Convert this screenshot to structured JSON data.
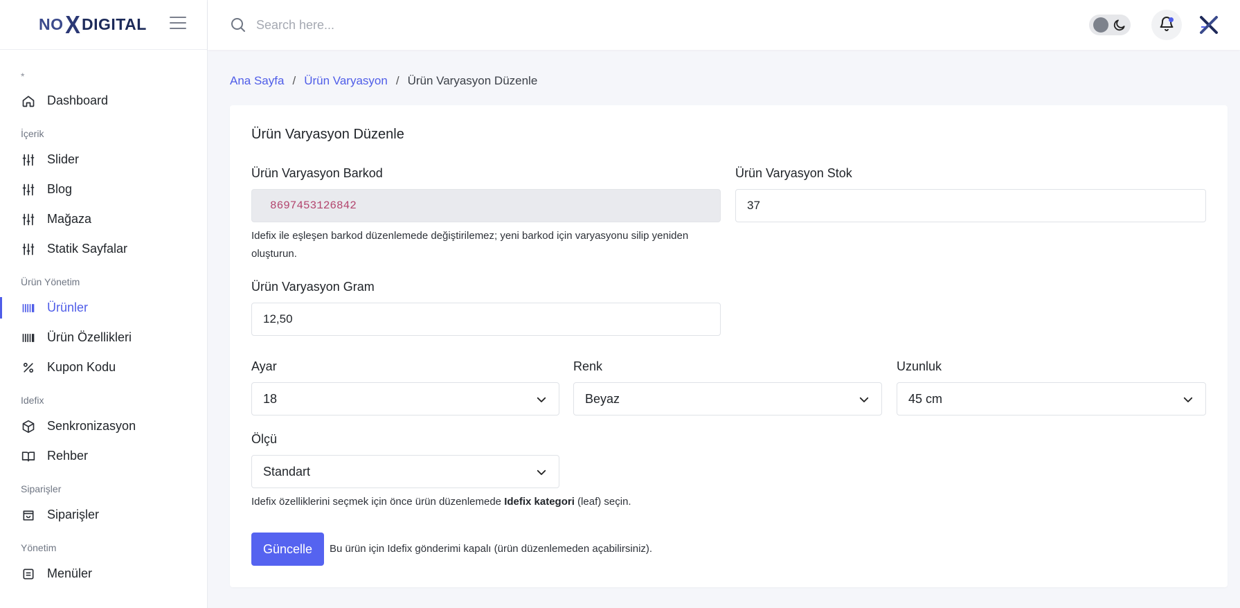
{
  "brand": {
    "logo_left": "NO",
    "logo_x": "X",
    "logo_right": "DIGITAL"
  },
  "colors": {
    "accent": "#4f5de8",
    "button": "#5563f0",
    "barcode_text": "#b3456e"
  },
  "sidebar": {
    "star": "*",
    "dashboard": "Dashboard",
    "sections": {
      "icerik": "İçerik",
      "urun_yonetim": "Ürün Yönetim",
      "idefix": "Idefix",
      "siparisler": "Siparişler",
      "yonetim": "Yönetim"
    },
    "items": {
      "slider": "Slider",
      "blog": "Blog",
      "magaza": "Mağaza",
      "statik": "Statik Sayfalar",
      "urunler": "Ürünler",
      "urun_ozellikleri": "Ürün Özellikleri",
      "kupon": "Kupon Kodu",
      "senkronizasyon": "Senkronizasyon",
      "rehber": "Rehber",
      "siparisler": "Siparişler",
      "menuler": "Menüler"
    },
    "icons": {
      "dashboard": "home-icon",
      "slider": "sliders-icon",
      "blog": "sliders-icon",
      "magaza": "sliders-icon",
      "statik": "sliders-icon",
      "urunler": "barcode-icon",
      "urun_ozellikleri": "barcode-icon",
      "kupon": "percent-icon",
      "senkronizasyon": "box-icon",
      "rehber": "book-icon",
      "siparisler": "bag-icon",
      "menuler": "menu-icon"
    }
  },
  "topbar": {
    "search_placeholder": "Search here..."
  },
  "breadcrumb": {
    "home": "Ana Sayfa",
    "parent": "Ürün Varyasyon",
    "current": "Ürün Varyasyon Düzenle",
    "separator": "/"
  },
  "form": {
    "title": "Ürün Varyasyon Düzenle",
    "barkod_label": "Ürün Varyasyon Barkod",
    "barkod_value": "8697453126842",
    "barkod_help": "Idefix ile eşleşen barkod düzenlemede değiştirilemez; yeni barkod için varyasyonu silip yeniden oluşturun.",
    "stok_label": "Ürün Varyasyon Stok",
    "stok_value": "37",
    "gram_label": "Ürün Varyasyon Gram",
    "gram_value": "12,50",
    "ayar_label": "Ayar",
    "ayar_value": "18",
    "renk_label": "Renk",
    "renk_value": "Beyaz",
    "uzunluk_label": "Uzunluk",
    "uzunluk_value": "45 cm",
    "olcu_label": "Ölçü",
    "olcu_value": "Standart",
    "idefix_help_pre": "Idefix özelliklerini seçmek için önce ürün düzenlemede ",
    "idefix_help_bold": "Idefix kategori",
    "idefix_help_post": " (leaf) seçin.",
    "submit_label": "Güncelle",
    "submit_note": "Bu ürün için Idefix gönderimi kapalı (ürün düzenlemeden açabilirsiniz)."
  }
}
